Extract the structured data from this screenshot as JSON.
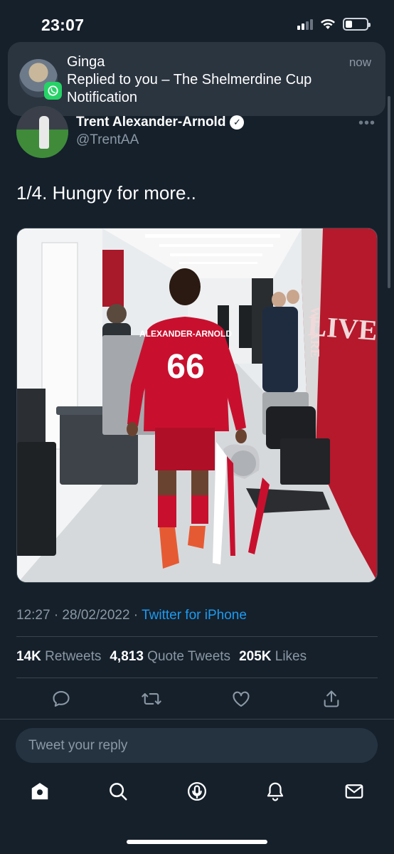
{
  "status_bar": {
    "time": "23:07",
    "icons": [
      "signal-icon",
      "wifi-icon",
      "battery-icon"
    ]
  },
  "notification": {
    "sender": "Ginga",
    "time": "now",
    "line1": "Replied to you – The Shelmerdine Cup",
    "line2": "Notification",
    "app_icon": "whatsapp-icon"
  },
  "tweet": {
    "author_name": "Trent Alexander-Arnold",
    "handle": "@TrentAA",
    "text": "1/4. Hungry for more..",
    "timestamp": "12:27 · 28/02/2022",
    "separator": " · ",
    "source": "Twitter for iPhone",
    "photo_jersey_name": "ALEXANDER-ARNOLD",
    "photo_jersey_number": "66",
    "photo_wall_text": "LIVERPO",
    "photo_wall_text_side": "WE ARE"
  },
  "stats": {
    "retweets_count": "14K",
    "retweets_label": "Retweets",
    "quotes_count": "4,813",
    "quotes_label": "Quote Tweets",
    "likes_count": "205K",
    "likes_label": "Likes"
  },
  "actions": [
    "reply-icon",
    "retweet-icon",
    "like-icon",
    "share-icon"
  ],
  "reply": {
    "placeholder": "Tweet your reply"
  },
  "nav": [
    "home-icon",
    "search-icon",
    "spaces-icon",
    "notifications-icon",
    "messages-icon"
  ],
  "colors": {
    "background": "#15202b",
    "accent": "#1d9bf0",
    "muted": "#8b98a5",
    "notification_bg": "#2b3540",
    "whatsapp": "#25d366",
    "kit_red": "#c8102e"
  }
}
